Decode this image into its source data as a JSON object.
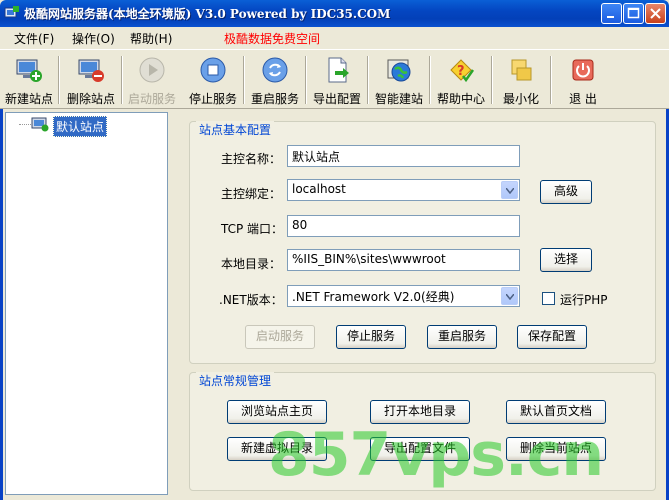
{
  "window": {
    "title": "极酷网站服务器(本地全环境版) V3.0 Powered by IDC35.COM"
  },
  "menu": {
    "items": [
      "文件(F)",
      "操作(O)",
      "帮助(H)"
    ],
    "promo": "极酷数据免费空间"
  },
  "toolbar": {
    "buttons": [
      {
        "label": "新建站点",
        "icon": "new-site-icon",
        "enabled": true
      },
      {
        "label": "删除站点",
        "icon": "delete-site-icon",
        "enabled": true
      },
      {
        "label": "启动服务",
        "icon": "play-icon",
        "enabled": false
      },
      {
        "label": "停止服务",
        "icon": "stop-icon",
        "enabled": true
      },
      {
        "label": "重启服务",
        "icon": "restart-icon",
        "enabled": true
      },
      {
        "label": "导出配置",
        "icon": "export-icon",
        "enabled": true
      },
      {
        "label": "智能建站",
        "icon": "globe-icon",
        "enabled": true
      },
      {
        "label": "帮助中心",
        "icon": "help-icon",
        "enabled": true
      },
      {
        "label": "最小化",
        "icon": "minimize-icon",
        "enabled": true
      },
      {
        "label": "退 出",
        "icon": "power-icon",
        "enabled": true
      }
    ]
  },
  "tree": {
    "items": [
      {
        "label": "默认站点",
        "selected": true
      }
    ]
  },
  "basic_config": {
    "title": "站点基本配置",
    "host_name_label": "主控名称：",
    "host_name_value": "默认站点",
    "host_bind_label": "主控绑定：",
    "host_bind_value": "localhost",
    "advanced_button": "高级",
    "tcp_port_label": "TCP 端口：",
    "tcp_port_value": "80",
    "local_dir_label": "本地目录：",
    "local_dir_value": "%IIS_BIN%\\sites\\wwwroot",
    "choose_button": "选择",
    "net_version_label": ".NET版本：",
    "net_version_value": ".NET Framework V2.0(经典)",
    "run_php_label": "运行PHP",
    "run_php_checked": false,
    "start_service_button": "启动服务",
    "stop_service_button": "停止服务",
    "restart_service_button": "重启服务",
    "save_config_button": "保存配置"
  },
  "management": {
    "title": "站点常规管理",
    "browse_home_button": "浏览站点主页",
    "open_local_dir_button": "打开本地目录",
    "default_doc_button": "默认首页文档",
    "new_virtual_dir_button": "新建虚拟目录",
    "export_config_file_button": "导出配置文件",
    "delete_site_button": "删除当前站点"
  },
  "watermark": "857vps.cn",
  "colors": {
    "titlebar": "#0446c1",
    "group_title": "#0046d5",
    "promo": "#ff0000",
    "selection": "#316ac5"
  }
}
